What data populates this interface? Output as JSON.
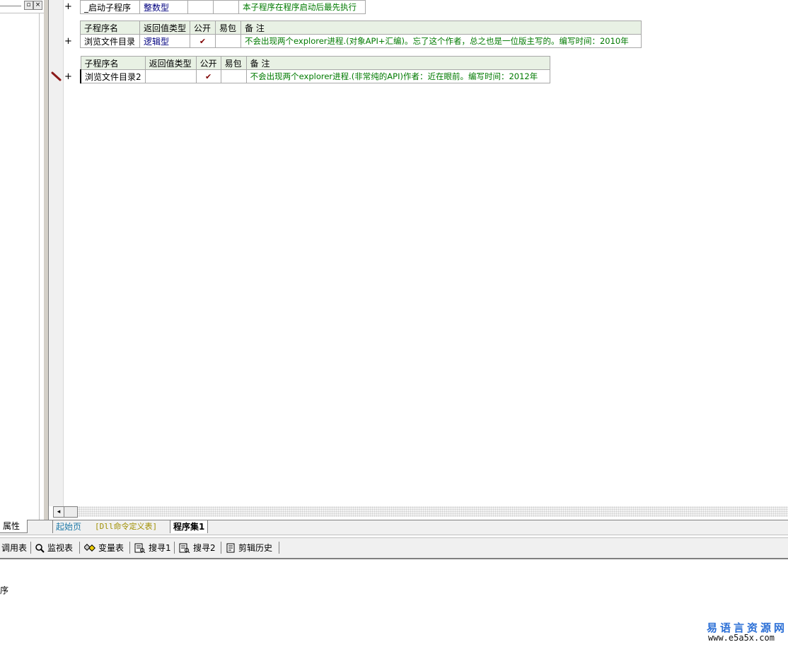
{
  "window": {
    "restore_glyph": "▫",
    "close_glyph": "×"
  },
  "routines": [
    {
      "show_header": false,
      "name": "_启动子程序",
      "return_type": "整数型",
      "public": "",
      "easy_pack": "",
      "remark": "本子程序在程序启动后最先执行"
    },
    {
      "show_header": true,
      "name": "浏览文件目录",
      "return_type": "逻辑型",
      "public": "✔",
      "easy_pack": "",
      "remark": "不会出现两个explorer进程.(对象API+汇编)。忘了这个作者，总之也是一位版主写的。编写时间：2010年"
    },
    {
      "show_header": true,
      "name": "浏览文件目录2",
      "return_type": "",
      "public": "✔",
      "easy_pack": "",
      "remark": "不会出现两个explorer进程.(非常纯的API)作者：近在眼前。编写时间：2012年"
    }
  ],
  "table_headers": {
    "name": "子程序名",
    "return_type": "返回值类型",
    "public": "公开",
    "easy_pack": "易包",
    "remark": "备 注"
  },
  "expand_glyph": "+",
  "tabs": {
    "properties": "属性",
    "start_page": "起始页",
    "dll_table": "[Dll命令定义表]",
    "program_set": "程序集1"
  },
  "bottom_toolbar": [
    {
      "label": "调用表",
      "icon": "call-table-icon",
      "glyph": ""
    },
    {
      "label": "监视表",
      "icon": "magnifier-icon",
      "glyph": "🔍"
    },
    {
      "label": "变量表",
      "icon": "variables-icon",
      "glyph": "◈"
    },
    {
      "label": "搜寻1",
      "icon": "search-results-icon",
      "glyph": "⎘"
    },
    {
      "label": "搜寻2",
      "icon": "search-results-icon",
      "glyph": "⎘"
    },
    {
      "label": "剪辑历史",
      "icon": "clipboard-history-icon",
      "glyph": "🗐"
    }
  ],
  "output": {
    "text": "序"
  },
  "watermark": {
    "title": "易语言资源网",
    "url": "www.e5a5x.com"
  },
  "colors": {
    "header_bg": "#e8f1e4",
    "type_text": "#00007f",
    "remark_text": "#007a00",
    "check_mark": "#7f0000"
  }
}
